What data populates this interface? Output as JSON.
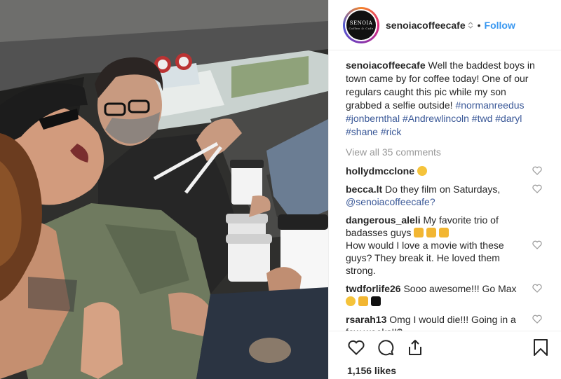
{
  "header": {
    "username": "senoiacoffeecafe",
    "follow_label": "Follow",
    "separator": "•",
    "avatar_text": "SENOIA",
    "avatar_subtext": "Coffee & Cafe"
  },
  "caption": {
    "username": "senoiacoffeecafe",
    "text": "Well the baddest boys in town came by for coffee today! One of our regulars caught this pic while my son grabbed a selfie outside!",
    "tags": [
      "#normanreedus",
      "#jonbernthal",
      "#Andrewlincoln",
      "#twd",
      "#daryl",
      "#shane",
      "#rick"
    ]
  },
  "view_all": "View all 35 comments",
  "comments": [
    {
      "user": "hollydmcclone",
      "text": "",
      "emoji": "grin"
    },
    {
      "user": "becca.lt",
      "text": "Do they film on Saturdays,",
      "mention": "@senoiacoffeecafe?"
    },
    {
      "user": "dangerous_aleli",
      "text": "My favorite trio of badasses guys",
      "text2": "How would I love a movie with these guys? They break it. He loved them strong."
    },
    {
      "user": "twdforlife26",
      "text": "Sooo awesome!!! Go Max"
    },
    {
      "user": "rsarah13",
      "text": "Omg I would die!!! Going in a few weeks!!$"
    }
  ],
  "likes": "1,156 likes",
  "icons": {
    "like": "heart-outline-icon",
    "comment": "speech-bubble-icon",
    "share": "share-upload-icon",
    "save": "bookmark-icon",
    "comment_like": "small-heart-icon"
  },
  "colors": {
    "link": "#3897f0",
    "hashtag": "#3b5998",
    "muted": "#999999",
    "text": "#262626",
    "border": "#efefef"
  }
}
